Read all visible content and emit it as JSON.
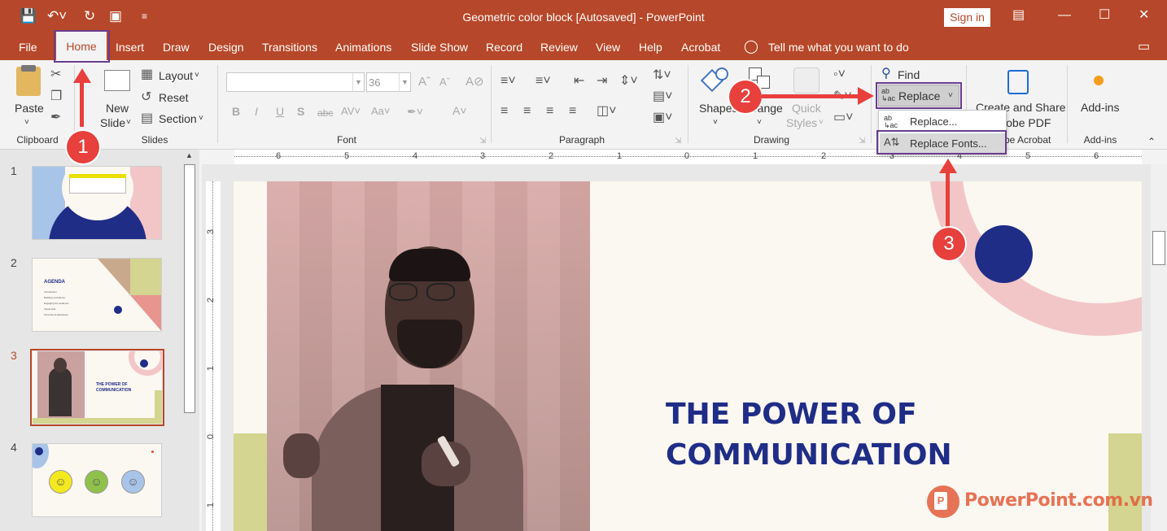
{
  "window": {
    "title": "Geometric color block [Autosaved] - PowerPoint",
    "signin": "Sign in"
  },
  "tabs": [
    "File",
    "Home",
    "Insert",
    "Draw",
    "Design",
    "Transitions",
    "Animations",
    "Slide Show",
    "Record",
    "Review",
    "View",
    "Help",
    "Acrobat"
  ],
  "tell_me": "Tell me what you want to do",
  "ribbon": {
    "clipboard": {
      "label": "Clipboard",
      "paste": "Paste"
    },
    "slides": {
      "label": "Slides",
      "new": "New",
      "slide": "Slide",
      "layout": "Layout",
      "reset": "Reset",
      "section": "Section"
    },
    "font": {
      "label": "Font",
      "size": "36"
    },
    "paragraph": {
      "label": "Paragraph"
    },
    "drawing": {
      "label": "Drawing",
      "shapes": "Shapes",
      "arrange": "Arrange",
      "quick": "Quick",
      "styles": "Styles"
    },
    "editing": {
      "find": "Find",
      "replace": "Replace"
    },
    "acrobat": {
      "line1": "Create and Share",
      "line2": "Adobe PDF",
      "label": "Adobe Acrobat"
    },
    "addins": {
      "btn": "Add-ins",
      "label": "Add-ins"
    }
  },
  "replace_menu": {
    "item1": "Replace...",
    "item2": "Replace Fonts..."
  },
  "slides_panel": {
    "numbers": [
      "1",
      "2",
      "3",
      "4"
    ],
    "slide2": {
      "heading": "AGENDA",
      "items": [
        "Introduction",
        "Building confidence",
        "Engaging the audience",
        "Visual aids",
        "Final tips & takeaways"
      ]
    },
    "slide3": {
      "title": "THE POWER OF COMMUNICATION"
    }
  },
  "ruler_numbers": [
    "6",
    "5",
    "4",
    "3",
    "2",
    "1",
    "0",
    "1",
    "2",
    "3",
    "4",
    "5",
    "6"
  ],
  "vruler_numbers": [
    "3",
    "2",
    "1",
    "0",
    "1"
  ],
  "slide": {
    "title_line1": "THE POWER OF",
    "title_line2": "COMMUNICATION"
  },
  "annotations": [
    "1",
    "2",
    "3"
  ],
  "watermark": "PowerPoint.com.vn",
  "colors": {
    "accent": "#b7472a",
    "navy": "#1f2d87",
    "pink": "#f2c6c7",
    "olive": "#d3d590",
    "badge": "#e8403c",
    "highlight": "#6a3d8f"
  }
}
